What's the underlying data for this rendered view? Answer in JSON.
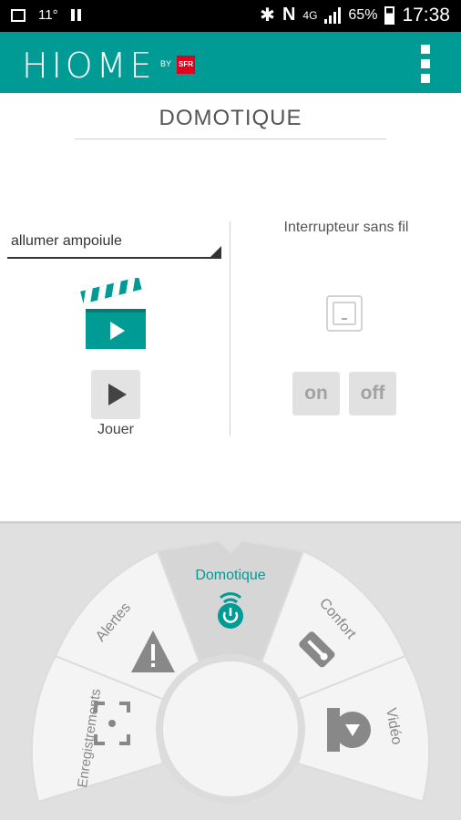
{
  "status": {
    "temperature": "11°",
    "network": "4G",
    "battery": "65%",
    "time": "17:38"
  },
  "appbar": {
    "logo_text": "HIOME",
    "logo_by": "BY",
    "logo_brand": "SFR"
  },
  "page": {
    "title": "DOMOTIQUE"
  },
  "scenario": {
    "selected": "allumer ampoiule",
    "play_label": "Jouer"
  },
  "device": {
    "name": "Interrupteur sans fil",
    "on_label": "on",
    "off_label": "off"
  },
  "nav": {
    "enregistrements": "Enregistrements",
    "alertes": "Alertes",
    "domotique": "Domotique",
    "confort": "Confort",
    "video": "Vidéo"
  },
  "colors": {
    "accent": "#009b94",
    "brand": "#e2001a"
  }
}
